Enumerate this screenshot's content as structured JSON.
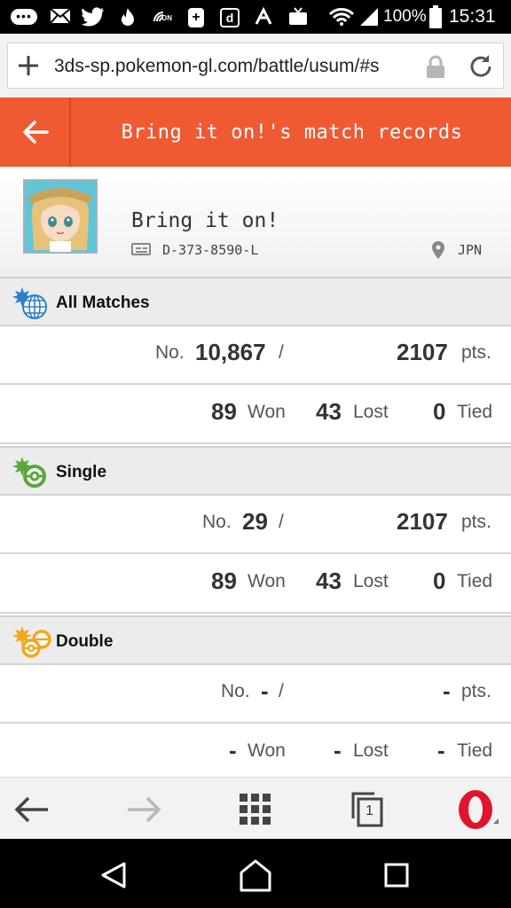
{
  "status_bar": {
    "icons": [
      "chat-icon",
      "mail-icon",
      "twitter-icon",
      "fire-icon",
      "nfc-on-icon",
      "plus-box-icon",
      "d-box-icon",
      "signal-app-icon",
      "tv-icon",
      "wifi-icon",
      "cell-signal-icon",
      "battery-icon"
    ],
    "nfc_label": "ON",
    "plus_label": "+",
    "d_label": "d",
    "battery": "100%",
    "time": "15:31"
  },
  "browser": {
    "url": "3ds-sp.pokemon-gl.com/battle/usum/#s",
    "tab_count": "1"
  },
  "header": {
    "title": "Bring it on!'s match records"
  },
  "profile": {
    "name": "Bring it on!",
    "id": "D-373-8590-L",
    "country": "JPN"
  },
  "labels": {
    "no": "No.",
    "pts": "pts.",
    "won": "Won",
    "lost": "Lost",
    "tied": "Tied"
  },
  "sections": [
    {
      "title": "All Matches",
      "rank": "10,867",
      "points": "2107",
      "won": "89",
      "lost": "43",
      "tied": "0",
      "color": "#2f7fc8"
    },
    {
      "title": "Single",
      "rank": "29",
      "points": "2107",
      "won": "89",
      "lost": "43",
      "tied": "0",
      "color": "#5aa83c"
    },
    {
      "title": "Double",
      "rank": "-",
      "points": "-",
      "won": "-",
      "lost": "-",
      "tied": "-",
      "color": "#f0a91e"
    }
  ],
  "colors": {
    "accent": "#ef5a33",
    "section_bg": "#ececec",
    "opera_red": "#e0152b"
  }
}
